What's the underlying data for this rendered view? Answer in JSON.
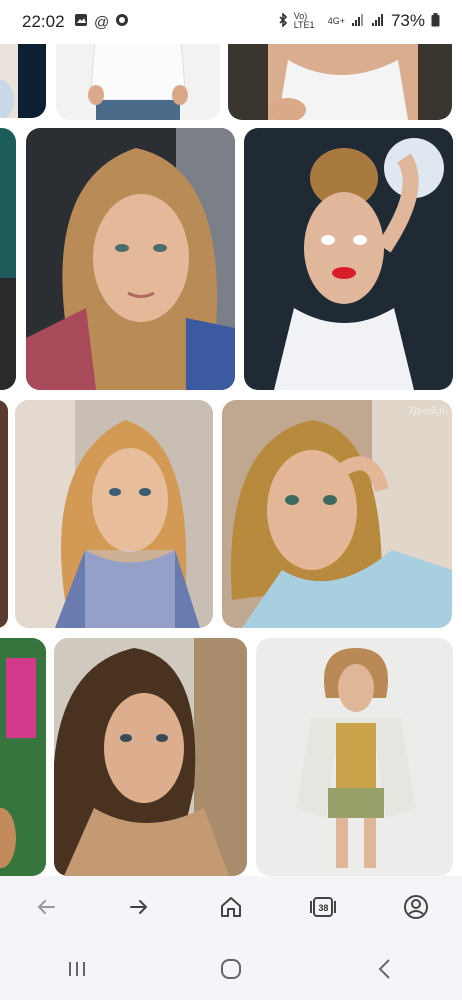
{
  "status_bar": {
    "time": "22:02",
    "network_label": "Vo) LTE1",
    "data_label": "4G+",
    "battery": "73%"
  },
  "tiles": [
    {
      "watermark": ""
    },
    {
      "watermark": "7дней.ru"
    }
  ],
  "bottom_nav": {
    "tab_count": "38"
  },
  "colors": {
    "background": "#ffffff",
    "nav_background": "#f5f4f8",
    "icon": "#444444"
  }
}
